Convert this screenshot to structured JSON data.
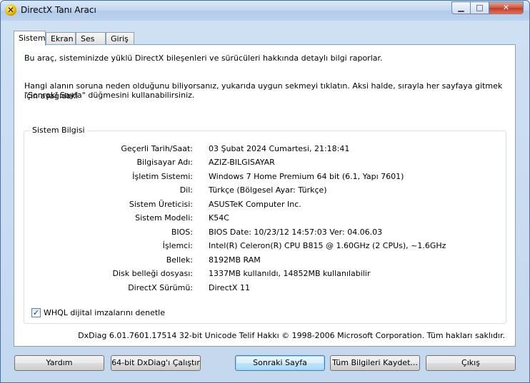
{
  "window": {
    "title": "DirectX Tanı Aracı"
  },
  "title_controls": {
    "minimize": "▁",
    "maximize": "□",
    "close": "✕"
  },
  "tabs": [
    {
      "label": "Sistem",
      "active": true
    },
    {
      "label": "Ekran",
      "active": false
    },
    {
      "label": "Ses",
      "active": false
    },
    {
      "label": "Giriş",
      "active": false
    }
  ],
  "description": {
    "line1": "Bu araç, sisteminizde yüklü DirectX bileşenleri ve sürücüleri hakkında detaylı bilgi raporlar.",
    "line2": "Hangi alanın soruna neden olduğunu biliyorsanız, yukarıda uygun sekmeyi tıklatın.  Aksi halde, sırayla her sayfaya gitmek için aşağıdaki",
    "line3": "\"Sonraki Sayfa\" düğmesini kullanabilirsiniz."
  },
  "system_info": {
    "group_title": "Sistem Bilgisi",
    "rows": [
      {
        "label": "Geçerli Tarih/Saat:",
        "value": "03 Şubat 2024 Cumartesi, 21:18:41"
      },
      {
        "label": "Bilgisayar Adı:",
        "value": "AZIZ-BILGISAYAR"
      },
      {
        "label": "İşletim Sistemi:",
        "value": "Windows 7 Home Premium 64 bit (6.1, Yapı 7601)"
      },
      {
        "label": "Dil:",
        "value": "Türkçe (Bölgesel Ayar: Türkçe)"
      },
      {
        "label": "Sistem Üreticisi:",
        "value": "ASUSTeK Computer Inc."
      },
      {
        "label": "Sistem Modeli:",
        "value": "K54C"
      },
      {
        "label": "BIOS:",
        "value": "BIOS Date: 10/23/12 14:57:03 Ver: 04.06.03"
      },
      {
        "label": "İşlemci:",
        "value": "Intel(R) Celeron(R) CPU B815 @ 1.60GHz (2 CPUs), ~1.6GHz"
      },
      {
        "label": "Bellek:",
        "value": "8192MB RAM"
      },
      {
        "label": "Disk belleği dosyası:",
        "value": "1337MB kullanıldı, 14852MB kullanılabilir"
      },
      {
        "label": "DirectX Sürümü:",
        "value": "DirectX 11"
      }
    ]
  },
  "whql": {
    "label": "WHQL dijital imzalarını denetle",
    "checked": true,
    "check_glyph": "✓"
  },
  "footer": {
    "text": "DxDiag 6.01.7601.17514 32-bit Unicode  Telif Hakkı © 1998-2006 Microsoft Corporation.  Tüm hakları saklıdır."
  },
  "buttons": {
    "help": "Yardım",
    "run64": "64-bit DxDiag'ı Çalıştır",
    "next": "Sonraki Sayfa",
    "save_all": "Tüm Bilgileri Kaydet...",
    "exit": "Çıkış"
  }
}
